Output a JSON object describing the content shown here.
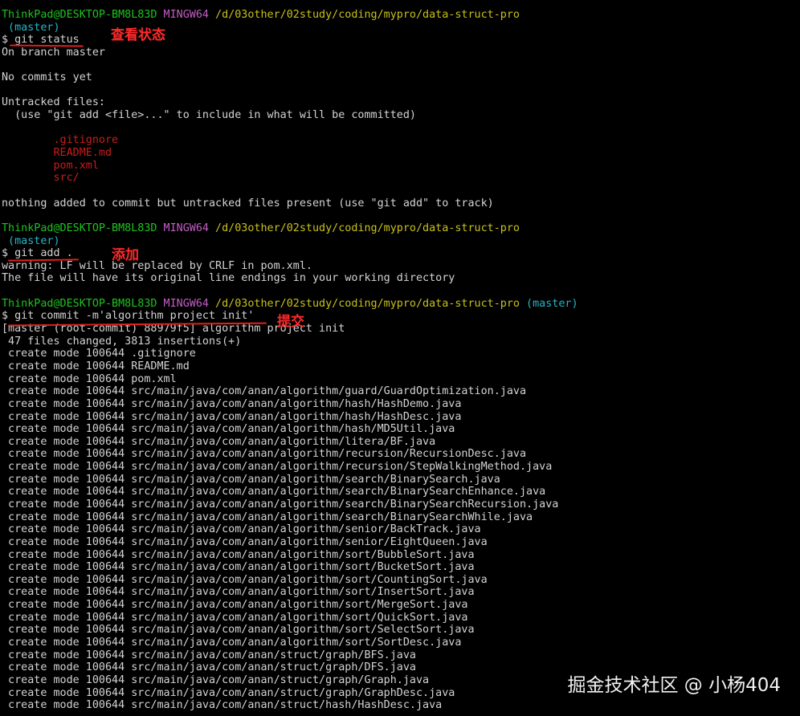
{
  "terminal": {
    "colors": {
      "green": "#1fc21f",
      "purple": "#c45ec4",
      "yellow": "#c8c11a",
      "cyan": "#22b8c8",
      "red": "#c81d1d",
      "white": "#d3d3d3"
    },
    "lines": [
      [
        [
          "ThinkPad@DESKTOP-BM8L83D",
          "green"
        ],
        [
          " ",
          "white"
        ],
        [
          "MINGW64",
          "purple"
        ],
        [
          " ",
          "white"
        ],
        [
          "/d/03other/02study/coding/mypro/data-struct-pro",
          "yellow"
        ]
      ],
      [
        [
          " (master)",
          "cyan"
        ]
      ],
      [
        [
          "$ git status",
          "white"
        ]
      ],
      [
        [
          "On branch master",
          "white"
        ]
      ],
      [
        [
          "",
          "white"
        ]
      ],
      [
        [
          "No commits yet",
          "white"
        ]
      ],
      [
        [
          "",
          "white"
        ]
      ],
      [
        [
          "Untracked files:",
          "white"
        ]
      ],
      [
        [
          "  (use \"git add <file>...\" to include in what will be committed)",
          "white"
        ]
      ],
      [
        [
          "",
          "white"
        ]
      ],
      [
        [
          "        .gitignore",
          "red"
        ]
      ],
      [
        [
          "        README.md",
          "red"
        ]
      ],
      [
        [
          "        pom.xml",
          "red"
        ]
      ],
      [
        [
          "        src/",
          "red"
        ]
      ],
      [
        [
          "",
          "white"
        ]
      ],
      [
        [
          "nothing added to commit but untracked files present (use \"git add\" to track)",
          "white"
        ]
      ],
      [
        [
          "",
          "white"
        ]
      ],
      [
        [
          "ThinkPad@DESKTOP-BM8L83D",
          "green"
        ],
        [
          " ",
          "white"
        ],
        [
          "MINGW64",
          "purple"
        ],
        [
          " ",
          "white"
        ],
        [
          "/d/03other/02study/coding/mypro/data-struct-pro",
          "yellow"
        ]
      ],
      [
        [
          " (master)",
          "cyan"
        ]
      ],
      [
        [
          "$ git add .",
          "white"
        ]
      ],
      [
        [
          "warning: LF will be replaced by CRLF in pom.xml.",
          "white"
        ]
      ],
      [
        [
          "The file will have its original line endings in your working directory",
          "white"
        ]
      ],
      [
        [
          "",
          "white"
        ]
      ],
      [
        [
          "ThinkPad@DESKTOP-BM8L83D",
          "green"
        ],
        [
          " ",
          "white"
        ],
        [
          "MINGW64",
          "purple"
        ],
        [
          " ",
          "white"
        ],
        [
          "/d/03other/02study/coding/mypro/data-struct-pro",
          "yellow"
        ],
        [
          " ",
          "white"
        ],
        [
          "(master)",
          "cyan"
        ]
      ],
      [
        [
          "$ git commit -m'algorithm project init'",
          "white"
        ]
      ],
      [
        [
          "[master (root-commit) 88979f5] algorithm project init",
          "white"
        ]
      ],
      [
        [
          " 47 files changed, 3813 insertions(+)",
          "white"
        ]
      ],
      [
        [
          " create mode 100644 .gitignore",
          "white"
        ]
      ],
      [
        [
          " create mode 100644 README.md",
          "white"
        ]
      ],
      [
        [
          " create mode 100644 pom.xml",
          "white"
        ]
      ],
      [
        [
          " create mode 100644 src/main/java/com/anan/algorithm/guard/GuardOptimization.java",
          "white"
        ]
      ],
      [
        [
          " create mode 100644 src/main/java/com/anan/algorithm/hash/HashDemo.java",
          "white"
        ]
      ],
      [
        [
          " create mode 100644 src/main/java/com/anan/algorithm/hash/HashDesc.java",
          "white"
        ]
      ],
      [
        [
          " create mode 100644 src/main/java/com/anan/algorithm/hash/MD5Util.java",
          "white"
        ]
      ],
      [
        [
          " create mode 100644 src/main/java/com/anan/algorithm/litera/BF.java",
          "white"
        ]
      ],
      [
        [
          " create mode 100644 src/main/java/com/anan/algorithm/recursion/RecursionDesc.java",
          "white"
        ]
      ],
      [
        [
          " create mode 100644 src/main/java/com/anan/algorithm/recursion/StepWalkingMethod.java",
          "white"
        ]
      ],
      [
        [
          " create mode 100644 src/main/java/com/anan/algorithm/search/BinarySearch.java",
          "white"
        ]
      ],
      [
        [
          " create mode 100644 src/main/java/com/anan/algorithm/search/BinarySearchEnhance.java",
          "white"
        ]
      ],
      [
        [
          " create mode 100644 src/main/java/com/anan/algorithm/search/BinarySearchRecursion.java",
          "white"
        ]
      ],
      [
        [
          " create mode 100644 src/main/java/com/anan/algorithm/search/BinarySearchWhile.java",
          "white"
        ]
      ],
      [
        [
          " create mode 100644 src/main/java/com/anan/algorithm/senior/BackTrack.java",
          "white"
        ]
      ],
      [
        [
          " create mode 100644 src/main/java/com/anan/algorithm/senior/EightQueen.java",
          "white"
        ]
      ],
      [
        [
          " create mode 100644 src/main/java/com/anan/algorithm/sort/BubbleSort.java",
          "white"
        ]
      ],
      [
        [
          " create mode 100644 src/main/java/com/anan/algorithm/sort/BucketSort.java",
          "white"
        ]
      ],
      [
        [
          " create mode 100644 src/main/java/com/anan/algorithm/sort/CountingSort.java",
          "white"
        ]
      ],
      [
        [
          " create mode 100644 src/main/java/com/anan/algorithm/sort/InsertSort.java",
          "white"
        ]
      ],
      [
        [
          " create mode 100644 src/main/java/com/anan/algorithm/sort/MergeSort.java",
          "white"
        ]
      ],
      [
        [
          " create mode 100644 src/main/java/com/anan/algorithm/sort/QuickSort.java",
          "white"
        ]
      ],
      [
        [
          " create mode 100644 src/main/java/com/anan/algorithm/sort/SelectSort.java",
          "white"
        ]
      ],
      [
        [
          " create mode 100644 src/main/java/com/anan/algorithm/sort/SortDesc.java",
          "white"
        ]
      ],
      [
        [
          " create mode 100644 src/main/java/com/anan/struct/graph/BFS.java",
          "white"
        ]
      ],
      [
        [
          " create mode 100644 src/main/java/com/anan/struct/graph/DFS.java",
          "white"
        ]
      ],
      [
        [
          " create mode 100644 src/main/java/com/anan/struct/graph/Graph.java",
          "white"
        ]
      ],
      [
        [
          " create mode 100644 src/main/java/com/anan/struct/graph/GraphDesc.java",
          "white"
        ]
      ],
      [
        [
          " create mode 100644 src/main/java/com/anan/struct/hash/HashDesc.java",
          "white"
        ]
      ]
    ]
  },
  "annotations": {
    "status_label": "查看状态",
    "add_label": "添加",
    "commit_label": "提交",
    "color": "#ff2a2a"
  },
  "watermark": {
    "text": "掘金技术社区 @ 小杨404"
  }
}
